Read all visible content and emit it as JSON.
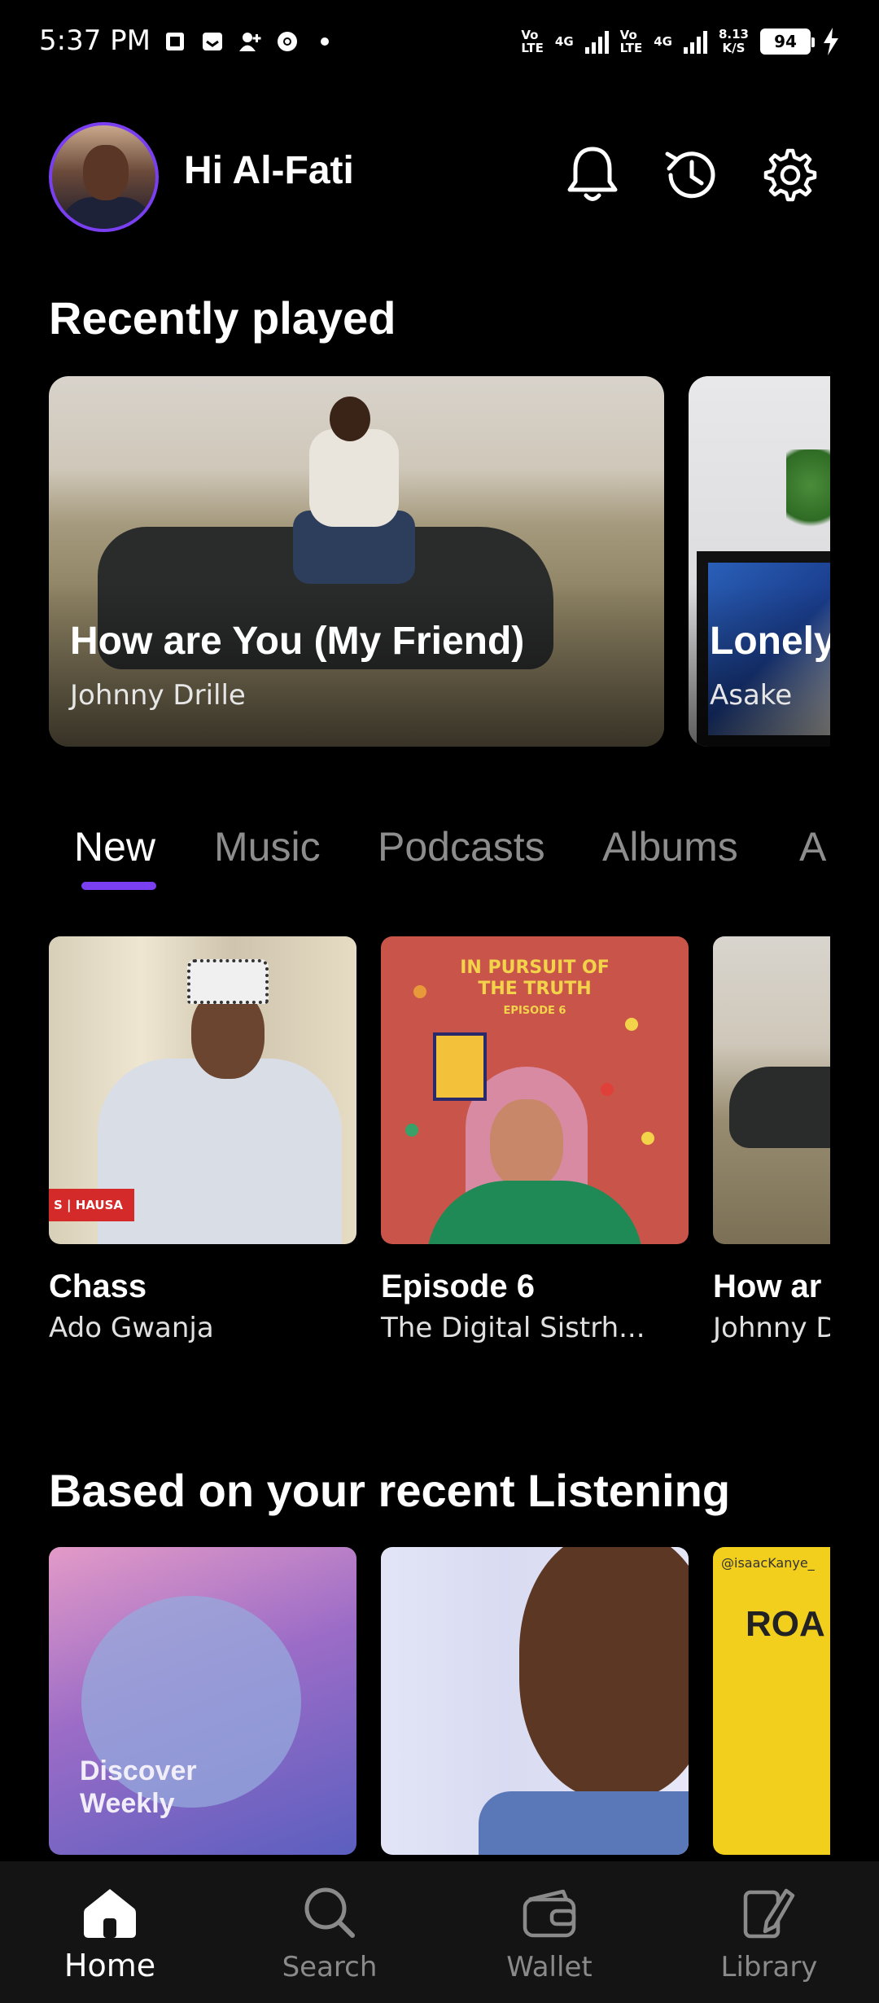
{
  "status_bar": {
    "time": "5:37 PM",
    "net1_top": "Vo",
    "net1_bottom": "LTE",
    "net1_type": "4G",
    "net2_top": "Vo",
    "net2_bottom": "LTE",
    "net2_type": "4G",
    "speed_value": "8.13",
    "speed_unit": "K/S",
    "battery": "94"
  },
  "header": {
    "greeting": "Hi Al-Fati"
  },
  "recently_played": {
    "title": "Recently played",
    "items": [
      {
        "title": "How are You (My Friend)",
        "artist": "Johnny Drille"
      },
      {
        "title": "Lonely",
        "artist": "Asake"
      }
    ]
  },
  "tabs": [
    "New",
    "Music",
    "Podcasts",
    "Albums",
    "A"
  ],
  "new_items": [
    {
      "title": "Chass",
      "subtitle": "Ado Gwanja",
      "badge": "S | HAUSA"
    },
    {
      "title": "Episode 6",
      "subtitle": "The Digital Sistrh...",
      "cover_line1": "IN PURSUIT OF",
      "cover_line2": "THE TRUTH",
      "cover_line3": "EPISODE 6"
    },
    {
      "title": "How ar",
      "subtitle": "Johnny D"
    }
  ],
  "based_on": {
    "title": "Based on your recent Listening",
    "items": [
      {
        "label_line1": "Discover",
        "label_line2": "Weekly"
      },
      {},
      {
        "handle": "@isaacKanye_",
        "word": "ROA"
      }
    ]
  },
  "bottom_nav": [
    {
      "label": "Home",
      "active": true
    },
    {
      "label": "Search",
      "active": false
    },
    {
      "label": "Wallet",
      "active": false
    },
    {
      "label": "Library",
      "active": false
    }
  ],
  "colors": {
    "accent": "#7b3ff2",
    "background": "#000000",
    "inactive": "#8d8d8d"
  }
}
